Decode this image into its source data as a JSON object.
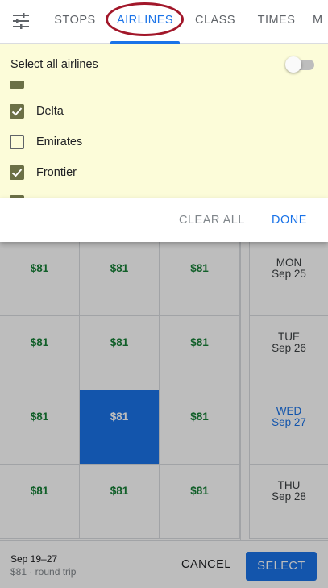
{
  "tabs": [
    {
      "label": "STOPS",
      "active": false
    },
    {
      "label": "AIRLINES",
      "active": true
    },
    {
      "label": "CLASS",
      "active": false
    },
    {
      "label": "TIMES",
      "active": false
    },
    {
      "label": "M",
      "active": false
    }
  ],
  "filter_icon": "tune-icon",
  "airline_panel": {
    "select_all_label": "Select all airlines",
    "select_all_on": false,
    "airlines": [
      {
        "name": "Delta",
        "checked": true
      },
      {
        "name": "Emirates",
        "checked": false
      },
      {
        "name": "Frontier",
        "checked": true
      }
    ],
    "clear_all_label": "CLEAR ALL",
    "done_label": "DONE"
  },
  "grid": {
    "rows": [
      {
        "prices": [
          "$81",
          "$81",
          "$81"
        ],
        "dow": "MON",
        "date": "Sep 25"
      },
      {
        "prices": [
          "$81",
          "$81",
          "$81"
        ],
        "dow": "TUE",
        "date": "Sep 26"
      },
      {
        "prices": [
          "$81",
          "$81",
          "$81"
        ],
        "dow": "WED",
        "date": "Sep 27"
      },
      {
        "prices": [
          "$81",
          "$81",
          "$81"
        ],
        "dow": "THU",
        "date": "Sep 28"
      }
    ],
    "selected": {
      "row": 2,
      "col": 1
    }
  },
  "footer": {
    "dates": "Sep 19–27",
    "price_summary": "$81 · round trip",
    "cancel_label": "CANCEL",
    "select_label": "SELECT"
  },
  "colors": {
    "accent": "#1a73e8",
    "price_green": "#188038",
    "panel_bg": "#fcfcd9",
    "checkbox_olive": "#6b7046",
    "highlight_ring": "#a2172a"
  }
}
